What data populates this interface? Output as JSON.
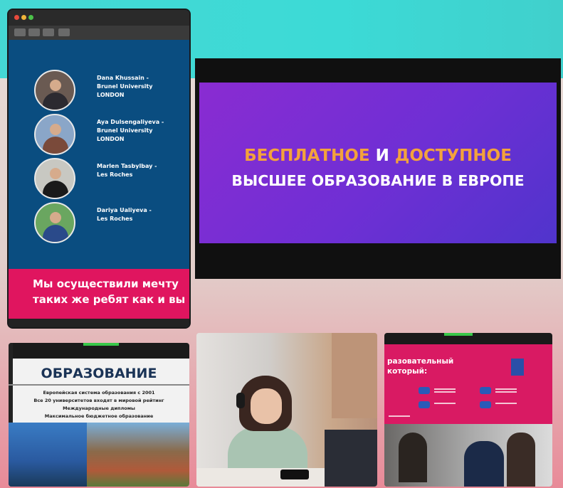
{
  "students": [
    {
      "name": "Dana Khussain -\nBrunel University\nLONDON"
    },
    {
      "name": "Aya Dulsengaliyeva -\nBrunel University\nLONDON"
    },
    {
      "name": "Marlen Tasbylbay -\nLes Roches"
    },
    {
      "name": "Dariya Ualiyeva -\nLes Roches"
    }
  ],
  "left_banner": {
    "line1": "Мы осуществили мечту",
    "line2": "таких же ребят как и вы"
  },
  "main_slide": {
    "word_free": "БЕСПЛАТНОЕ",
    "word_and": "И",
    "word_accessible": "ДОСТУПНОЕ",
    "line2": "ВЫСШЕЕ ОБРАЗОВАНИЕ В ЕВРОПЕ"
  },
  "education_tile": {
    "title": "ОБРАЗОВАНИЕ",
    "lines": [
      "Европейская система образования с 2001",
      "Все 20 университетов входят в мировой рейтинг",
      "Международные дипломы",
      "Максимальное бюджетное образование"
    ]
  },
  "slide2_tile": {
    "title_line1": "разовательный",
    "title_line2": "который:"
  },
  "colors": {
    "teal_bg": "#45d8d4",
    "slide_purple": "#7a2ed2",
    "accent_orange": "#f3a23c",
    "banner_pink": "#e0155f",
    "left_slide_blue": "#0a4d80"
  }
}
